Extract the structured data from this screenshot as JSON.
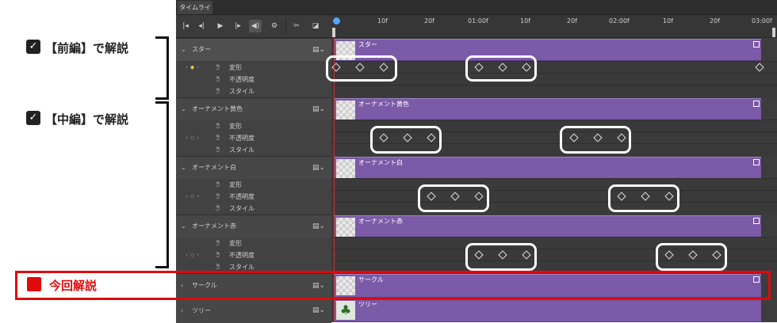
{
  "panel": {
    "tab_label": "タイムライン"
  },
  "toolbar": {
    "icons": [
      "first-frame-icon",
      "prev-frame-icon",
      "play-icon",
      "next-frame-icon",
      "audio-icon",
      "settings-icon",
      "scissors-icon",
      "transition-icon"
    ]
  },
  "ruler": {
    "ticks": [
      "10f",
      "20f",
      "01:00f",
      "10f",
      "20f",
      "02:00f",
      "10f",
      "20f",
      "03:00f"
    ]
  },
  "layers": [
    {
      "name": "スター",
      "props": [
        "変形",
        "不透明度",
        "スタイル"
      ]
    },
    {
      "name": "オーナメント黄色",
      "props": [
        "変形",
        "不透明度",
        "スタイル"
      ]
    },
    {
      "name": "オーナメント白",
      "props": [
        "変形",
        "不透明度",
        "スタイル"
      ]
    },
    {
      "name": "オーナメント赤",
      "props": [
        "変形",
        "不透明度",
        "スタイル"
      ]
    },
    {
      "name": "サークル"
    },
    {
      "name": "ツリー"
    }
  ],
  "annotations": {
    "front": "【前編】で解説",
    "middle": "【中編】で解説",
    "this_time": "今回解説"
  },
  "colors": {
    "clip": "#7b5aa8",
    "highlight": "#e00a0a",
    "playhead": "#d03030"
  }
}
